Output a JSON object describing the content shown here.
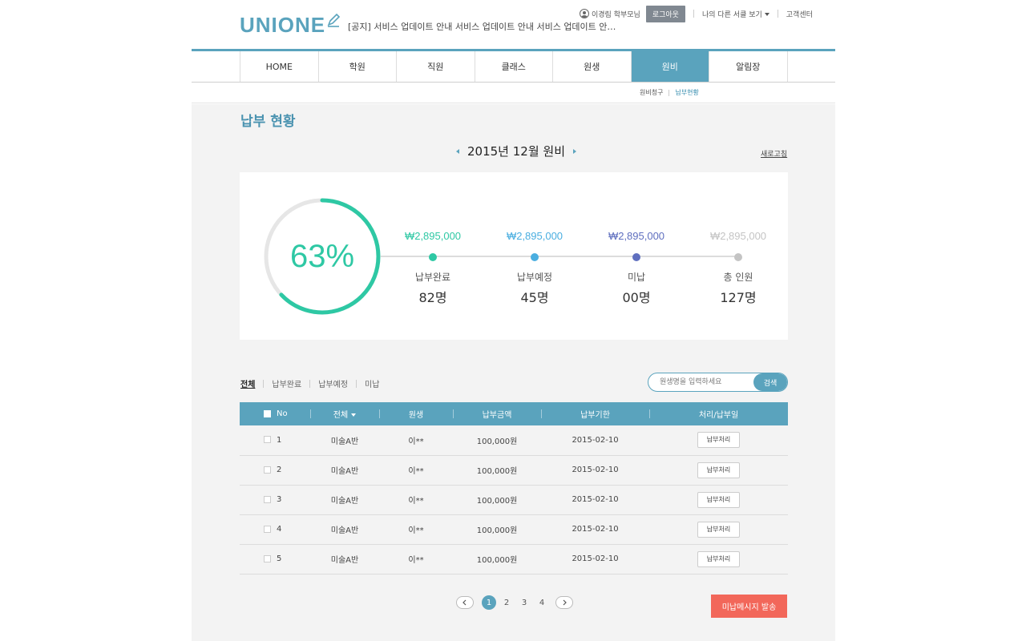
{
  "header": {
    "logo": "UNIONE",
    "notice": "[공지] 서비스 업데이트 안내 서비스 업데이트 안내 서비스 업데이트 안…",
    "user_name": "이경림 학부모님",
    "logout_label": "로그아웃",
    "other_view_label": "나의 다른 서클 보기",
    "support_label": "고객센터"
  },
  "gnb": {
    "items": [
      "HOME",
      "학원",
      "직원",
      "클래스",
      "원생",
      "원비",
      "알림장"
    ],
    "active": "원비"
  },
  "subnav": {
    "items": [
      "원비청구",
      "납부현황"
    ],
    "active": "납부현황"
  },
  "page": {
    "title": "납부 현황",
    "month": "2015년 12월 원비",
    "refresh_label": "새로고침"
  },
  "summary": {
    "percent_label": "63%",
    "percent_value": 0.63,
    "stats": [
      {
        "amount": "₩2,895,000",
        "label": "납부완료",
        "count": "82명",
        "color": "#2ec8a4"
      },
      {
        "amount": "₩2,895,000",
        "label": "납부예정",
        "count": "45명",
        "color": "#4aaee0"
      },
      {
        "amount": "₩2,895,000",
        "label": "미납",
        "count": "00명",
        "color": "#5f6fbf"
      },
      {
        "amount": "₩2,895,000",
        "label": "총 인원",
        "count": "127명",
        "color": "#c4c4c4"
      }
    ]
  },
  "filters": {
    "items": [
      "전체",
      "납부완료",
      "납부예정",
      "미납"
    ],
    "active": "전체"
  },
  "search": {
    "placeholder": "원생명을 입력하세요",
    "button_label": "검색"
  },
  "table": {
    "headers": [
      "No",
      "전체",
      "원생",
      "납부금액",
      "납부기한",
      "처리/납부일"
    ],
    "rows": [
      {
        "no": "1",
        "cls": "미술A반",
        "student": "이**",
        "amount": "100,000원",
        "due": "2015-02-10",
        "action": "납부처리"
      },
      {
        "no": "2",
        "cls": "미술A반",
        "student": "이**",
        "amount": "100,000원",
        "due": "2015-02-10",
        "action": "납부처리"
      },
      {
        "no": "3",
        "cls": "미술A반",
        "student": "이**",
        "amount": "100,000원",
        "due": "2015-02-10",
        "action": "납부처리"
      },
      {
        "no": "4",
        "cls": "미술A반",
        "student": "이**",
        "amount": "100,000원",
        "due": "2015-02-10",
        "action": "납부처리"
      },
      {
        "no": "5",
        "cls": "미술A반",
        "student": "이**",
        "amount": "100,000원",
        "due": "2015-02-10",
        "action": "납부처리"
      }
    ]
  },
  "pagination": {
    "pages": [
      "1",
      "2",
      "3",
      "4"
    ],
    "current": "1"
  },
  "send_button_label": "미납메시지 발송"
}
